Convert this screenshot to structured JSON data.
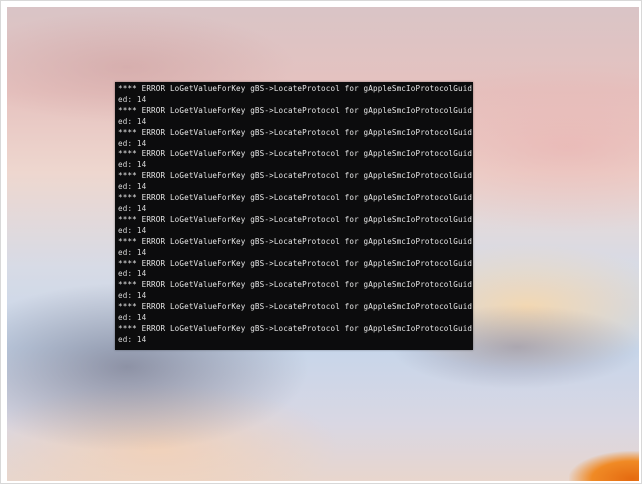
{
  "terminal": {
    "lines": [
      "**** ERROR LoGetValueForKey gBS->LocateProtocol for gAppleSmcIoProtocolGuid fail",
      "ed: 14",
      "**** ERROR LoGetValueForKey gBS->LocateProtocol for gAppleSmcIoProtocolGuid fail",
      "ed: 14",
      "**** ERROR LoGetValueForKey gBS->LocateProtocol for gAppleSmcIoProtocolGuid fail",
      "ed: 14",
      "**** ERROR LoGetValueForKey gBS->LocateProtocol for gAppleSmcIoProtocolGuid fail",
      "ed: 14",
      "**** ERROR LoGetValueForKey gBS->LocateProtocol for gAppleSmcIoProtocolGuid fail",
      "ed: 14",
      "**** ERROR LoGetValueForKey gBS->LocateProtocol for gAppleSmcIoProtocolGuid fail",
      "ed: 14",
      "**** ERROR LoGetValueForKey gBS->LocateProtocol for gAppleSmcIoProtocolGuid fail",
      "ed: 14",
      "**** ERROR LoGetValueForKey gBS->LocateProtocol for gAppleSmcIoProtocolGuid fail",
      "ed: 14",
      "**** ERROR LoGetValueForKey gBS->LocateProtocol for gAppleSmcIoProtocolGuid fail",
      "ed: 14",
      "**** ERROR LoGetValueForKey gBS->LocateProtocol for gAppleSmcIoProtocolGuid fail",
      "ed: 14",
      "**** ERROR LoGetValueForKey gBS->LocateProtocol for gAppleSmcIoProtocolGuid fail",
      "ed: 14",
      "**** ERROR LoGetValueForKey gBS->LocateProtocol for gAppleSmcIoProtocolGuid fail",
      "ed: 14",
      "**** ERROR LoGetValueForKey gBS->LocateProtocol for gAppleSmcIoProtocolGuid fail",
      "ed: 14"
    ]
  },
  "colors": {
    "terminal_background": "#0c0c0d",
    "terminal_text": "#d9d9d9"
  }
}
